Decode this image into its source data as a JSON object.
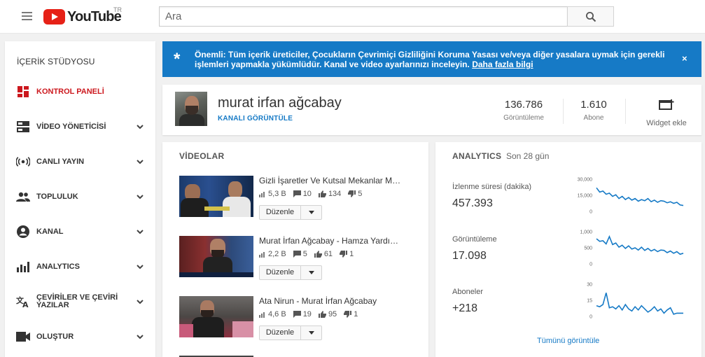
{
  "header": {
    "logo_text": "YouTube",
    "region": "TR",
    "search_placeholder": "Ara"
  },
  "sidebar": {
    "title": "İÇERİK STÜDYOSU",
    "items": [
      {
        "label": "KONTROL PANELİ",
        "icon": "dashboard-icon",
        "active": true
      },
      {
        "label": "VİDEO YÖNETİCİSİ",
        "icon": "video-manager-icon"
      },
      {
        "label": "CANLI YAYIN",
        "icon": "live-stream-icon"
      },
      {
        "label": "TOPLULUK",
        "icon": "community-icon"
      },
      {
        "label": "KANAL",
        "icon": "channel-icon"
      },
      {
        "label": "ANALYTICS",
        "icon": "analytics-icon"
      },
      {
        "label": "ÇEVİRİLER VE ÇEVİRİ YAZILAR",
        "icon": "translate-icon"
      },
      {
        "label": "OLUŞTUR",
        "icon": "create-icon"
      }
    ]
  },
  "notice": {
    "text": "Önemli: Tüm içerik üreticiler, Çocukların Çevrimiçi Gizliliğini Koruma Yasası ve/veya diğer yasalara uymak için gerekli işlemleri yapmakla yükümlüdür. Kanal ve video ayarlarınızı inceleyin.",
    "link": "Daha fazla bilgi",
    "close": "×",
    "color": "#167ac6"
  },
  "channel": {
    "name": "murat irfan ağcabay",
    "view_link": "KANALI GÖRÜNTÜLE",
    "views_value": "136.786",
    "views_label": "Görüntüleme",
    "subs_value": "1.610",
    "subs_label": "Abone",
    "widget_label": "Widget ekle"
  },
  "videos": {
    "title": "VİDEOLAR",
    "edit_label": "Düzenle",
    "items": [
      {
        "title": "Gizli İşaretler Ve Kutsal Mekanlar Murat İrfan Ağcabay",
        "views": "5,3 B",
        "comments": "10",
        "likes": "134",
        "dislikes": "5"
      },
      {
        "title": "Murat İrfan Ağcabay - Hamza Yardımcıoğlu",
        "views": "2,2 B",
        "comments": "5",
        "likes": "61",
        "dislikes": "1"
      },
      {
        "title": "Ata Nirun - Murat İrfan Ağcabay",
        "views": "4,6 B",
        "comments": "19",
        "likes": "95",
        "dislikes": "1"
      }
    ]
  },
  "analytics": {
    "title": "ANALYTICS",
    "period": "Son 28 gün",
    "see_all": "Tümünü görüntüle",
    "line_color": "#167ac6",
    "metrics": [
      {
        "label": "İzlenme süresi (dakika)",
        "value": "457.393",
        "ticks": [
          "30,000",
          "15,000",
          "0"
        ],
        "ymax": 30000,
        "series": [
          22000,
          18000,
          19000,
          16000,
          17000,
          14000,
          15500,
          12000,
          14000,
          11000,
          13000,
          10500,
          12000,
          9500,
          11000,
          10000,
          12000,
          9000,
          10500,
          8500,
          10000,
          9500,
          8000,
          9000,
          7500,
          8500,
          6000,
          5500
        ]
      },
      {
        "label": "Görüntüleme",
        "value": "17.098",
        "ticks": [
          "1,000",
          "500",
          "0"
        ],
        "ymax": 1000,
        "series": [
          780,
          700,
          720,
          620,
          850,
          600,
          650,
          520,
          580,
          480,
          560,
          460,
          500,
          430,
          520,
          420,
          480,
          400,
          450,
          380,
          430,
          420,
          350,
          400,
          330,
          380,
          300,
          330
        ]
      },
      {
        "label": "Aboneler",
        "value": "+218",
        "ticks": [
          "30",
          "15",
          "0"
        ],
        "ymax": 30,
        "series": [
          10,
          9,
          11,
          22,
          8,
          9,
          7,
          10,
          6,
          11,
          7,
          5,
          9,
          6,
          10,
          7,
          4,
          6,
          9,
          5,
          7,
          3,
          6,
          8,
          2,
          3,
          3,
          3
        ]
      }
    ]
  }
}
